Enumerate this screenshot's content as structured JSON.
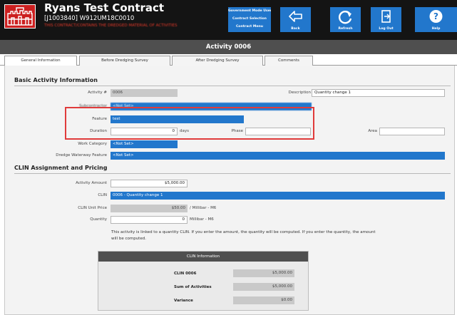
{
  "header": {
    "title": "Ryans Test Contract",
    "subtitle": "[J1003840] W912UM18C0010",
    "warning": "THIS CONTRACT/CONTAINS THE DREDGED MATERIAL OF ACTIVITIES",
    "mode_buttons": [
      "Government Mode Users",
      "Contract Selection",
      "Contract Menu"
    ],
    "toolbar": {
      "back": "Back",
      "refresh": "Refresh",
      "logout": "Log Out",
      "help": "Help"
    },
    "colors": {
      "header_bg": "#141414",
      "button_blue": "#2277cc",
      "logo_red": "#cc1f1f"
    }
  },
  "activity_title": "Activity 0006",
  "tabs": [
    "General Information",
    "Before Dredging Survey",
    "After Dredging Survey",
    "Comments"
  ],
  "basic": {
    "section_title": "Basic Activity Information",
    "activity_number_label": "Activity #",
    "activity_number": "0006",
    "description_label": "Description",
    "description": "Quantity change 1",
    "subcontractor_label": "Subcontractor",
    "subcontractor": "<Not Set>",
    "feature_label": "Feature",
    "feature": "test",
    "duration_label": "Duration",
    "duration": "0",
    "duration_unit": "days",
    "phase_label": "Phase",
    "phase": "",
    "area_label": "Area",
    "area": "",
    "work_category_label": "Work Category",
    "work_category": "<Not Set>",
    "waterway_feature_label": "Dredge Waterway Feature",
    "waterway_feature": "<Not Set>"
  },
  "clin": {
    "section_title": "CLIN Assignment and Pricing",
    "activity_amount_label": "Activity Amount",
    "activity_amount": "$5,000.00",
    "clin_label": "CLIN",
    "clin_value": "0006 - Quantity change 1",
    "unit_price_label": "CLIN Unit Price",
    "unit_price": "$50.00",
    "unit_price_unit": "/ Millibar - M6",
    "quantity_label": "Quantity",
    "quantity": "0",
    "quantity_unit": "Millibar - M6",
    "note": "This activity is linked to a quantity CLIN. If you enter the amount, the quantity will be computed. If you enter the quantity, the amount will be computed."
  },
  "clin_info": {
    "header": "CLIN Information",
    "rows": [
      {
        "label": "CLIN 0006",
        "value": "$5,000.00"
      },
      {
        "label": "Sum of Activities",
        "value": "$5,000.00"
      },
      {
        "label": "Variance",
        "value": "$0.00"
      }
    ]
  }
}
